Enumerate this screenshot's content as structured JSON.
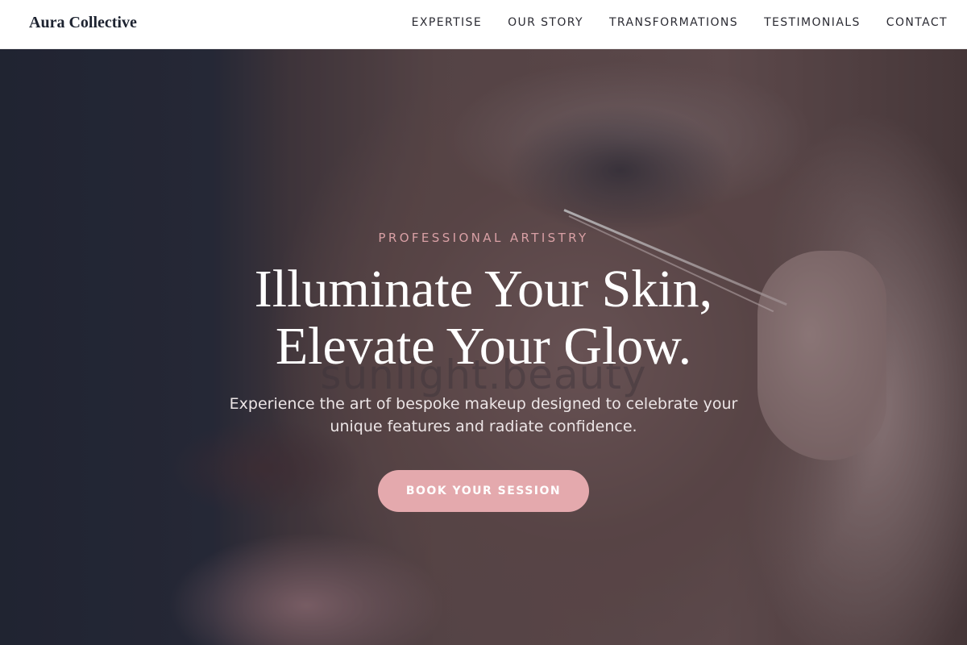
{
  "brand": {
    "name": "Aura Collective"
  },
  "nav": {
    "items": [
      {
        "label": "EXPERTISE"
      },
      {
        "label": "OUR STORY"
      },
      {
        "label": "TRANSFORMATIONS"
      },
      {
        "label": "TESTIMONIALS"
      },
      {
        "label": "CONTACT"
      }
    ]
  },
  "hero": {
    "eyebrow": "PROFESSIONAL ARTISTRY",
    "headline_line1": "Illuminate Your Skin,",
    "headline_line2": "Elevate Your Glow.",
    "subtext_line1": "Experience the art of bespoke makeup designed to celebrate your",
    "subtext_line2": "unique features and radiate confidence.",
    "cta_label": "BOOK YOUR SESSION",
    "watermark": "sunlight.beauty"
  },
  "colors": {
    "accent": "#e4a9ad",
    "eyebrow": "#d9a0a5",
    "brand_text": "#1d2330"
  }
}
